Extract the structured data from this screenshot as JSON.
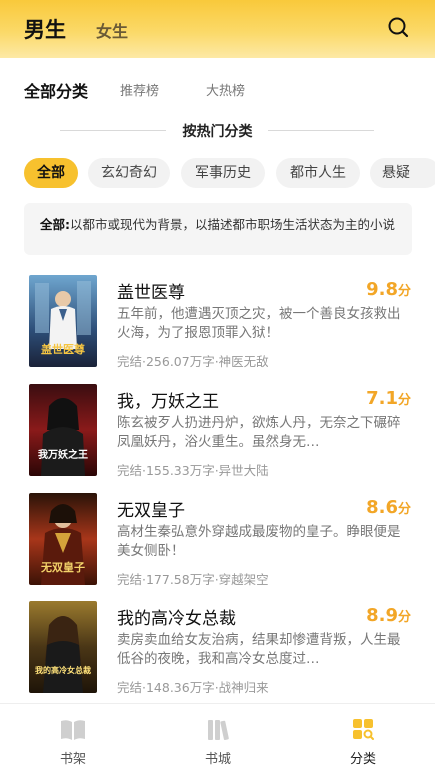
{
  "header": {
    "tab_male": "男生",
    "tab_female": "女生"
  },
  "cat_tabs": {
    "all": "全部分类",
    "recommend": "推荐榜",
    "hot": "大热榜"
  },
  "section_title": "按热门分类",
  "chips": [
    "全部",
    "玄幻奇幻",
    "军事历史",
    "都市人生",
    "悬疑"
  ],
  "description": {
    "label": "全部:",
    "text": "以都市或现代为背景，以描述都市职场生活状态为主的小说"
  },
  "books": [
    {
      "title": "盖世医尊",
      "score": "9.8",
      "unit": "分",
      "intro": "五年前，他遭遇灭顶之灾，被一个善良女孩救出火海，为了报恩顶罪入狱！",
      "meta": "完结·256.07万字·神医无敌",
      "cover_text": "盖世医尊"
    },
    {
      "title": "我，万妖之王",
      "score": "7.1",
      "unit": "分",
      "intro": "陈玄被歹人扔进丹炉，欲炼人丹，无奈之下碾碎凤凰妖丹，浴火重生。虽然身无…",
      "meta": "完结·155.33万字·异世大陆",
      "cover_text": "我万妖之王"
    },
    {
      "title": "无双皇子",
      "score": "8.6",
      "unit": "分",
      "intro": "高材生秦弘意外穿越成最废物的皇子。睁眼便是美女侧卧！",
      "meta": "完结·177.58万字·穿越架空",
      "cover_text": "无双皇子"
    },
    {
      "title": "我的高冷女总裁",
      "score": "8.9",
      "unit": "分",
      "intro": "卖房卖血给女友治病，结果却惨遭背叛，人生最低谷的夜晚，我和高冷女总度过…",
      "meta": "完结·148.36万字·战神归来",
      "cover_text": "我的高冷女总裁"
    }
  ],
  "bottom_nav": {
    "shelf": "书架",
    "store": "书城",
    "category": "分类"
  },
  "colors": {
    "accent": "#f7c12e",
    "score": "#f2a627",
    "header_top": "#f9c93b"
  }
}
